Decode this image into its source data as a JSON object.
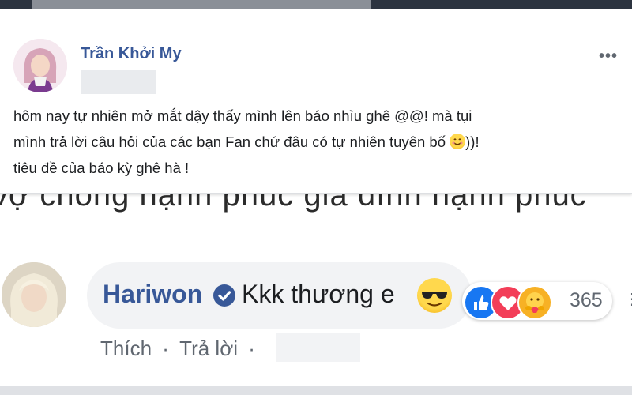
{
  "post": {
    "author": "Trần Khởi My",
    "more": "•••",
    "line1": "hôm nay tự nhiên mở mắt dậy thấy mình lên báo nhìu ghê @@! mà tụi",
    "line2_a": "mình trả lời câu hỏi của các bạn Fan chứ đâu có tự nhiên tuyên bố ",
    "line2_b": "))!",
    "line3": "tiêu đề của báo kỳ ghê hà !"
  },
  "background_article": {
    "text": "vợ chồng hạnh phúc gia đình hạnh phúc"
  },
  "comment": {
    "name": "Hariwon",
    "text": "Kkk thương e",
    "reaction_count": "365",
    "actions": {
      "like": "Thích",
      "separator": "·",
      "reply": "Trả lời",
      "separator2": "·"
    }
  },
  "colors": {
    "name_blue": "#385898",
    "like_blue": "#1877f2",
    "love_red": "#f33e58",
    "care_yellow": "#f7b125"
  }
}
